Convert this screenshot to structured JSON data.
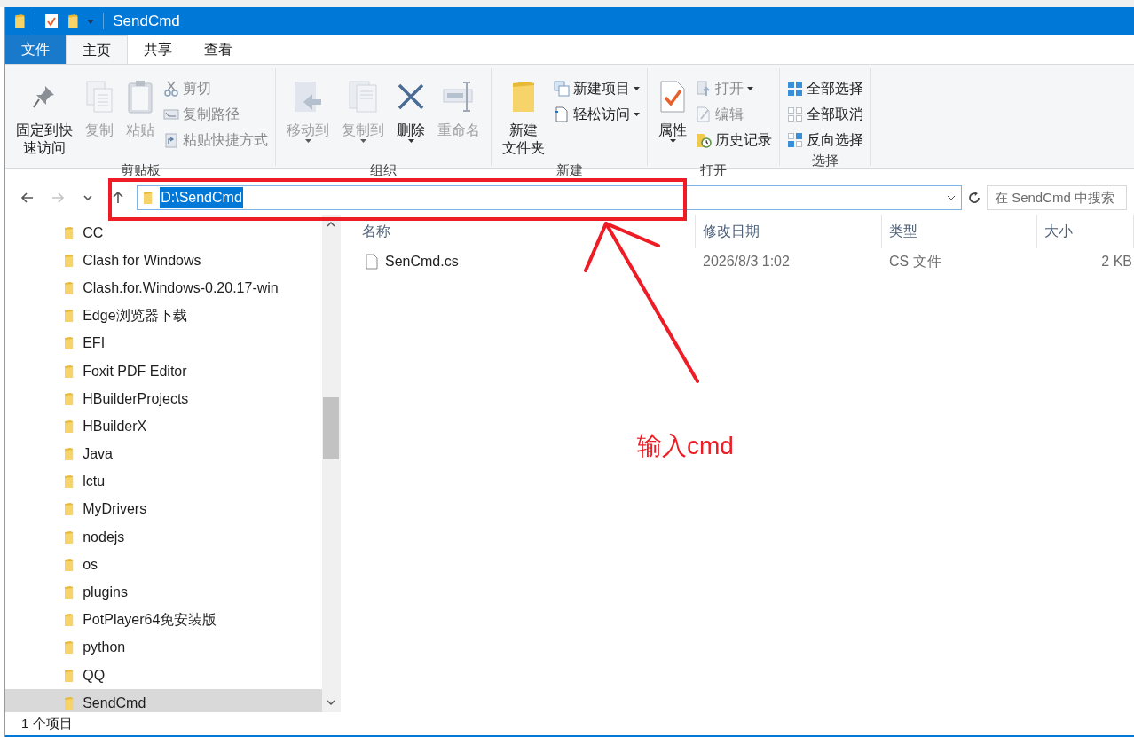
{
  "title_bar": {
    "title": "SendCmd"
  },
  "ribbon_tabs": [
    {
      "label": "文件",
      "kind": "file",
      "selected": false
    },
    {
      "label": "主页",
      "kind": "tab",
      "selected": true
    },
    {
      "label": "共享",
      "kind": "tab",
      "selected": false
    },
    {
      "label": "查看",
      "kind": "tab",
      "selected": false
    }
  ],
  "ribbon_groups": [
    {
      "label": "剪贴板",
      "buttons": [
        {
          "label": [
            "固定到快",
            "速访问"
          ],
          "kind": "large",
          "disabled": false,
          "dropdown": false
        },
        {
          "label": "复制",
          "kind": "large",
          "disabled": true,
          "dropdown": false
        },
        {
          "label": "粘贴",
          "kind": "large",
          "disabled": true,
          "dropdown": false
        },
        {
          "label": "剪切",
          "kind": "small",
          "disabled": true,
          "dropdown": false
        },
        {
          "label": "复制路径",
          "kind": "small",
          "disabled": true,
          "dropdown": false
        },
        {
          "label": "粘贴快捷方式",
          "kind": "small",
          "disabled": true,
          "dropdown": false
        }
      ]
    },
    {
      "label": "组织",
      "buttons": [
        {
          "label": "移动到",
          "kind": "large",
          "disabled": true,
          "dropdown": true
        },
        {
          "label": "复制到",
          "kind": "large",
          "disabled": true,
          "dropdown": true
        },
        {
          "label": "删除",
          "kind": "large",
          "disabled": false,
          "dropdown": true
        },
        {
          "label": "重命名",
          "kind": "large",
          "disabled": true,
          "dropdown": false
        }
      ]
    },
    {
      "label": "新建",
      "buttons": [
        {
          "label": [
            "新建",
            "文件夹"
          ],
          "kind": "large",
          "disabled": false,
          "dropdown": false
        },
        {
          "label": "新建项目",
          "kind": "small",
          "disabled": false,
          "dropdown": true
        },
        {
          "label": "轻松访问",
          "kind": "small",
          "disabled": false,
          "dropdown": true
        }
      ]
    },
    {
      "label": "打开",
      "buttons": [
        {
          "label": "属性",
          "kind": "large",
          "disabled": false,
          "dropdown": true
        },
        {
          "label": "打开",
          "kind": "small",
          "disabled": true,
          "dropdown": true
        },
        {
          "label": "编辑",
          "kind": "small",
          "disabled": true,
          "dropdown": false
        },
        {
          "label": "历史记录",
          "kind": "small",
          "disabled": false,
          "dropdown": false
        }
      ]
    },
    {
      "label": "选择",
      "buttons": [
        {
          "label": "全部选择",
          "kind": "small",
          "disabled": false,
          "dropdown": false
        },
        {
          "label": "全部取消",
          "kind": "small",
          "disabled": false,
          "dropdown": false
        },
        {
          "label": "反向选择",
          "kind": "small",
          "disabled": false,
          "dropdown": false
        }
      ]
    }
  ],
  "nav": [
    {
      "kind": "back",
      "disabled": false
    },
    {
      "kind": "forward",
      "disabled": true
    },
    {
      "kind": "recent",
      "disabled": false
    },
    {
      "kind": "up",
      "disabled": false
    }
  ],
  "address": {
    "value": "D:\\SendCmd",
    "selected": true
  },
  "search": {
    "placeholder": "在 SendCmd 中搜索"
  },
  "sidebar": {
    "items": [
      {
        "label": "CC",
        "selected": false
      },
      {
        "label": "Clash for Windows",
        "selected": false
      },
      {
        "label": "Clash.for.Windows-0.20.17-win",
        "selected": false
      },
      {
        "label": "Edge浏览器下载",
        "selected": false
      },
      {
        "label": "EFI",
        "selected": false
      },
      {
        "label": "Foxit PDF Editor",
        "selected": false
      },
      {
        "label": "HBuilderProjects",
        "selected": false
      },
      {
        "label": "HBuilderX",
        "selected": false
      },
      {
        "label": "Java",
        "selected": false
      },
      {
        "label": "lctu",
        "selected": false
      },
      {
        "label": "MyDrivers",
        "selected": false
      },
      {
        "label": "nodejs",
        "selected": false
      },
      {
        "label": "os",
        "selected": false
      },
      {
        "label": "plugins",
        "selected": false
      },
      {
        "label": "PotPlayer64免安装版",
        "selected": false
      },
      {
        "label": "python",
        "selected": false
      },
      {
        "label": "QQ",
        "selected": false
      },
      {
        "label": "SendCmd",
        "selected": true
      }
    ]
  },
  "table": {
    "columns": [
      "名称",
      "修改日期",
      "类型",
      "大小"
    ],
    "rows": [
      {
        "name": "SenCmd.cs",
        "modified": "2026/8/3 1:02",
        "type": "CS 文件",
        "size": "2 KB"
      }
    ]
  },
  "status_bar": {
    "text": "1 个项目"
  },
  "annotation": {
    "text": "输入cmd"
  }
}
